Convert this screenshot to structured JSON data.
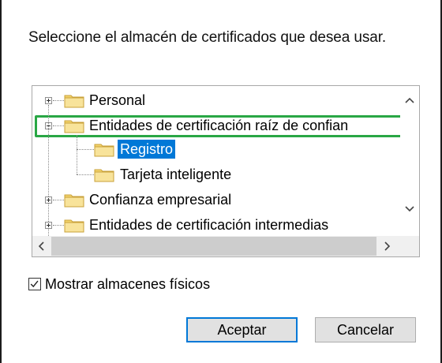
{
  "dialog": {
    "prompt": "Seleccione el almacén de certificados que desea usar."
  },
  "tree": {
    "items": [
      {
        "label": "Personal",
        "expander": "plus",
        "level": 0
      },
      {
        "label": "Entidades de certificación raíz de confian",
        "expander": "minus",
        "level": 0,
        "highlighted": true
      },
      {
        "label": "Registro",
        "level": 1,
        "selected": true
      },
      {
        "label": "Tarjeta inteligente",
        "level": 1
      },
      {
        "label": "Confianza empresarial",
        "expander": "plus",
        "level": 0
      },
      {
        "label": "Entidades de certificación intermedias",
        "expander": "plus",
        "level": 0
      }
    ]
  },
  "show_physical": {
    "label": "Mostrar almacenes físicos",
    "checked": true
  },
  "buttons": {
    "ok": "Aceptar",
    "cancel": "Cancelar"
  },
  "colors": {
    "selection": "#0078d7",
    "highlight_frame": "#29a745",
    "folder": "#f2d36b"
  }
}
